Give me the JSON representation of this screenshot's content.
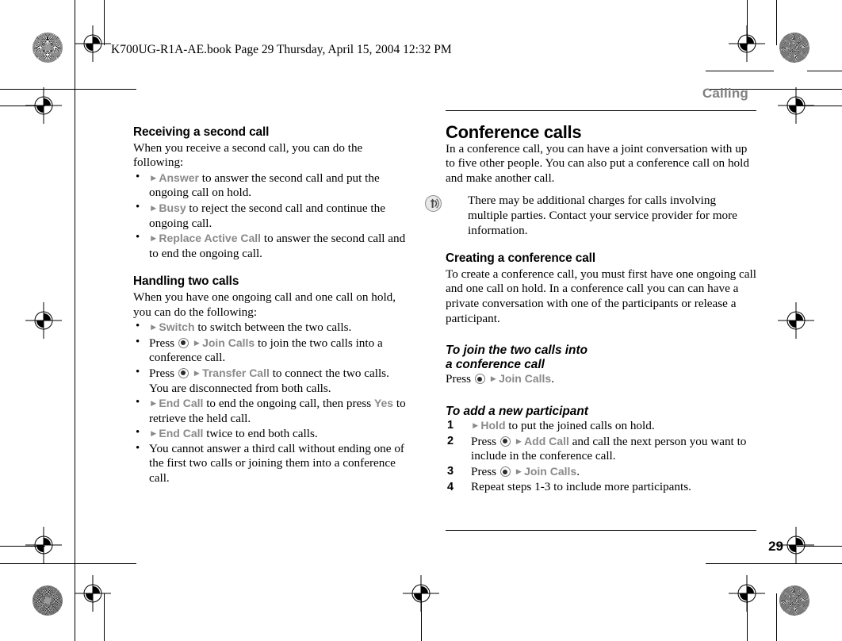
{
  "proof_header": {
    "text": "K700UG-R1A-AE.book  Page 29  Thursday, April 15, 2004  12:32 PM"
  },
  "running_head": "Calling",
  "folio": "29",
  "icons": {
    "joystick": "joystick-select-icon",
    "note": "note-signal-icon",
    "arrow": "►",
    "bullet": "•"
  },
  "colors": {
    "ui_label": "#8a8a8a",
    "running_head": "#808080",
    "body_text": "#000000"
  },
  "left_column": {
    "section1": {
      "heading": "Receiving a second call",
      "intro": "When you receive a second call, you can do the following:",
      "bullets": [
        {
          "pre": "",
          "key": "",
          "arrow_label": "Answer",
          "post": " to answer the second call and put the ongoing call on hold."
        },
        {
          "pre": "",
          "key": "",
          "arrow_label": "Busy",
          "post": " to reject the second call and continue the ongoing call."
        },
        {
          "pre": "",
          "key": "",
          "arrow_label": "Replace Active Call",
          "post": " to answer the second call and to end the ongoing call."
        }
      ]
    },
    "section2": {
      "heading": "Handling two calls",
      "intro": "When you have one ongoing call and one call on hold, you can do the following:",
      "bullets": [
        {
          "pre": "",
          "joystick": false,
          "arrow_label": "Switch",
          "post": " to switch between the two calls."
        },
        {
          "pre": "Press ",
          "joystick": true,
          "arrow_label": "Join Calls",
          "post": " to join the two calls into a conference call."
        },
        {
          "pre": "Press ",
          "joystick": true,
          "arrow_label": "Transfer Call",
          "post": " to connect the two calls. You are disconnected from both calls."
        },
        {
          "pre": "",
          "joystick": false,
          "arrow_label": "End Call",
          "post": " to end the ongoing call, then press ",
          "ui_tail": "Yes",
          "post2": " to retrieve the held call."
        },
        {
          "pre": "",
          "joystick": false,
          "arrow_label": "End Call",
          "post": " twice to end both calls."
        },
        {
          "plain": "You cannot answer a third call without ending one of the first two calls or joining them into a conference call."
        }
      ]
    }
  },
  "right_column": {
    "title": "Conference calls",
    "intro": "In a conference call, you can have a joint conversation with up to five other people. You can also put a conference call on hold and make another call.",
    "note": "There may be additional charges for calls involving multiple parties. Contact your service provider for more information.",
    "section1": {
      "heading": "Creating a conference call",
      "body": "To create a conference call, you must first have one ongoing call and one call on hold. In a conference call you can can have a private conversation with one of the participants or release a participant."
    },
    "procedure1": {
      "heading_line1": "To join the two calls into",
      "heading_line2": "a conference call",
      "pre": "Press ",
      "joystick": true,
      "arrow_label": "Join Calls",
      "post": "."
    },
    "procedure2": {
      "heading": "To add a new participant",
      "steps": [
        {
          "n": "1",
          "pre": "",
          "joystick": false,
          "arrow_label": "Hold",
          "post": " to put the joined calls on hold."
        },
        {
          "n": "2",
          "pre": "Press ",
          "joystick": true,
          "arrow_label": "Add Call",
          "post": " and call the next person you want to include in the conference call."
        },
        {
          "n": "3",
          "pre": "Press ",
          "joystick": true,
          "arrow_label": "Join Calls",
          "post": "."
        },
        {
          "n": "4",
          "plain": "Repeat steps 1-3 to include more participants."
        }
      ]
    }
  }
}
